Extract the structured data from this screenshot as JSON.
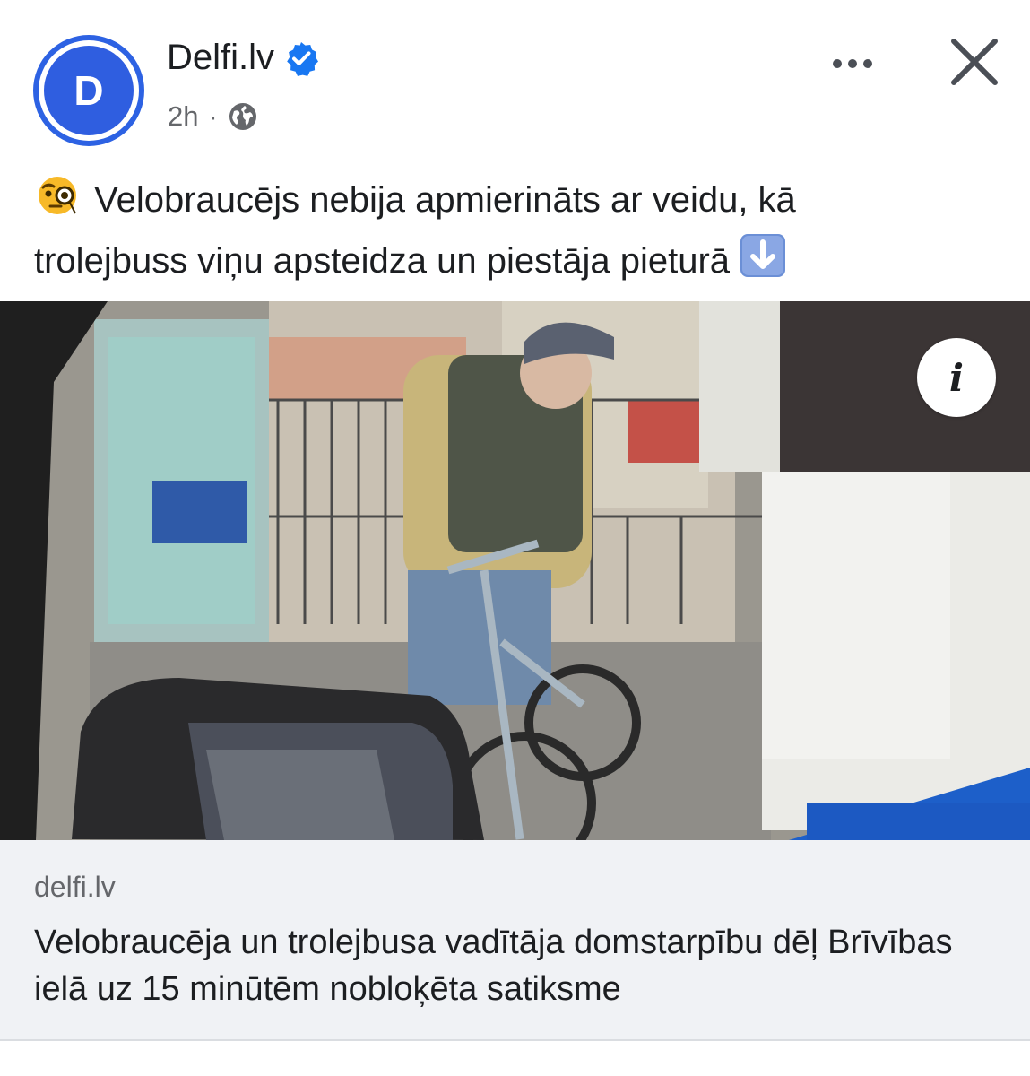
{
  "post": {
    "page_name": "Delfi.lv",
    "avatar_letter": "D",
    "verified_icon": "verified-badge-icon",
    "time": "2h",
    "separator": "·",
    "audience_icon": "globe-icon",
    "more_icon": "more-options-icon",
    "close_icon": "close-icon",
    "caption_line1": "Velobraucējs nebija apmierināts ar veidu, kā",
    "caption_line2": "trolejbuss viņu apsteidza un piestāja pieturā",
    "caption_leading_emoji": "face-with-monocle",
    "caption_trailing_emoji": "down-arrow",
    "media_info_label": "i",
    "brand_color": "#2d62e3"
  },
  "link_preview": {
    "domain": "delfi.lv",
    "title": "Velobraucēja un trolejbusa vadītāja domstarpību dēļ Brīvības ielā uz 15 minūtēm nobloķēta satiksme",
    "background": "#f0f2f5"
  }
}
